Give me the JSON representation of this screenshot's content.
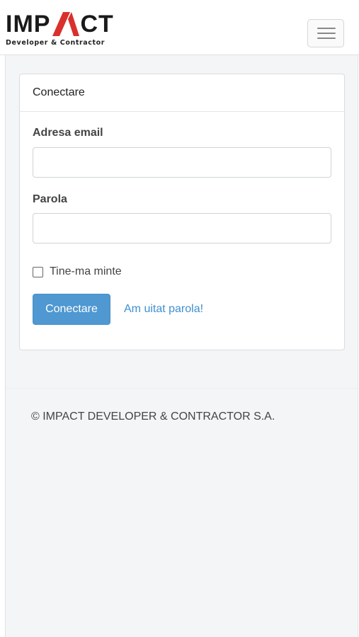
{
  "header": {
    "logo_text_left": "IMP",
    "logo_text_right": "CT",
    "logo_tagline": "Developer & Contractor",
    "brand_accent": "#d9302c",
    "menu_icon": "hamburger-icon"
  },
  "login_card": {
    "title": "Conectare",
    "email_label": "Adresa email",
    "email_value": "",
    "password_label": "Parola",
    "password_value": "",
    "remember_label": "Tine-ma minte",
    "remember_checked": false,
    "submit_label": "Conectare",
    "submit_color": "#4f98d1",
    "forgot_label": "Am uitat parola!",
    "link_color": "#3f8fd0"
  },
  "footer": {
    "copyright": "© IMPACT DEVELOPER & CONTRACTOR S.A."
  }
}
